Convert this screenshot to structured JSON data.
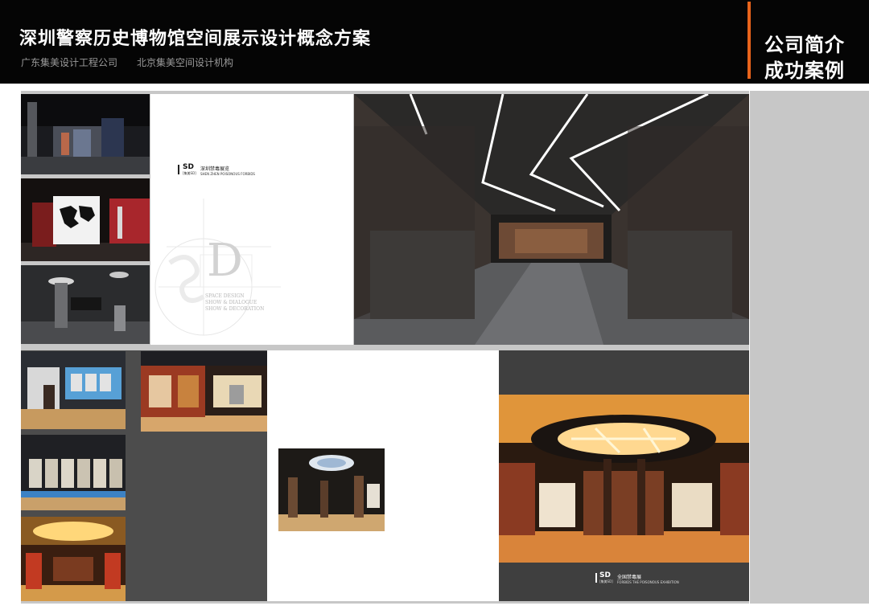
{
  "header": {
    "title": "深圳警察历史博物馆空间展示设计概念方案",
    "company1": "广东集美设计工程公司",
    "company2": "北京集美空间设计机构",
    "section_line1": "公司简介",
    "section_line2": "成功案例",
    "accent_color": "#e8641b"
  },
  "brochure1": {
    "logo": "SD",
    "logo_sub": "[集美SD]",
    "name_cn": "深圳禁毒展览",
    "name_en": "SHEN ZHEN POISONOUS FORBIDS",
    "big_letter": "D",
    "tagline1": "SPACE DESIGN",
    "tagline2": "SHOW & DIALOGUE",
    "tagline3": "SHOW & DECORATION"
  },
  "brochure2": {
    "logo": "SD",
    "logo_sub": "[集美SD]",
    "name_cn": "全国禁毒展",
    "name_en": "FORBIDS THE POISONOUS EXHIBITION"
  }
}
